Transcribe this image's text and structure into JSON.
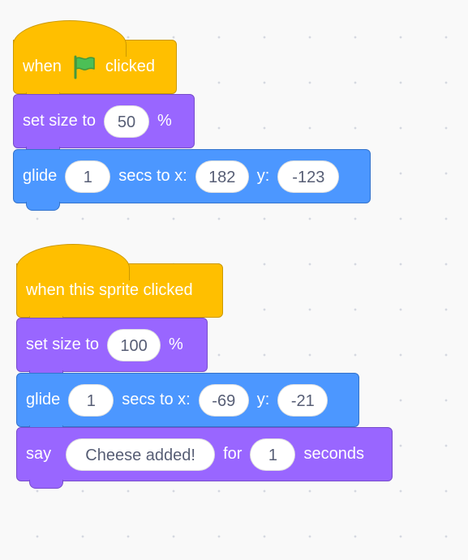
{
  "script1": {
    "hat": {
      "when": "when",
      "clicked": "clicked"
    },
    "set_size": {
      "label": "set size to",
      "value": "50",
      "unit": "%"
    },
    "glide": {
      "label": "glide",
      "secs": "1",
      "secs_to_x": "secs to x:",
      "x": "182",
      "y_label": "y:",
      "y": "-123"
    }
  },
  "script2": {
    "hat": {
      "label": "when this sprite clicked"
    },
    "set_size": {
      "label": "set size to",
      "value": "100",
      "unit": "%"
    },
    "glide": {
      "label": "glide",
      "secs": "1",
      "secs_to_x": "secs to x:",
      "x": "-69",
      "y_label": "y:",
      "y": "-21"
    },
    "say": {
      "label": "say",
      "message": "Cheese added!",
      "for": "for",
      "secs": "1",
      "seconds": "seconds"
    }
  },
  "colors": {
    "events": "#ffbf00",
    "looks": "#9966ff",
    "motion": "#4c97ff",
    "flag": "#4cbf56"
  },
  "icons": {
    "flag": "green-flag-icon"
  }
}
